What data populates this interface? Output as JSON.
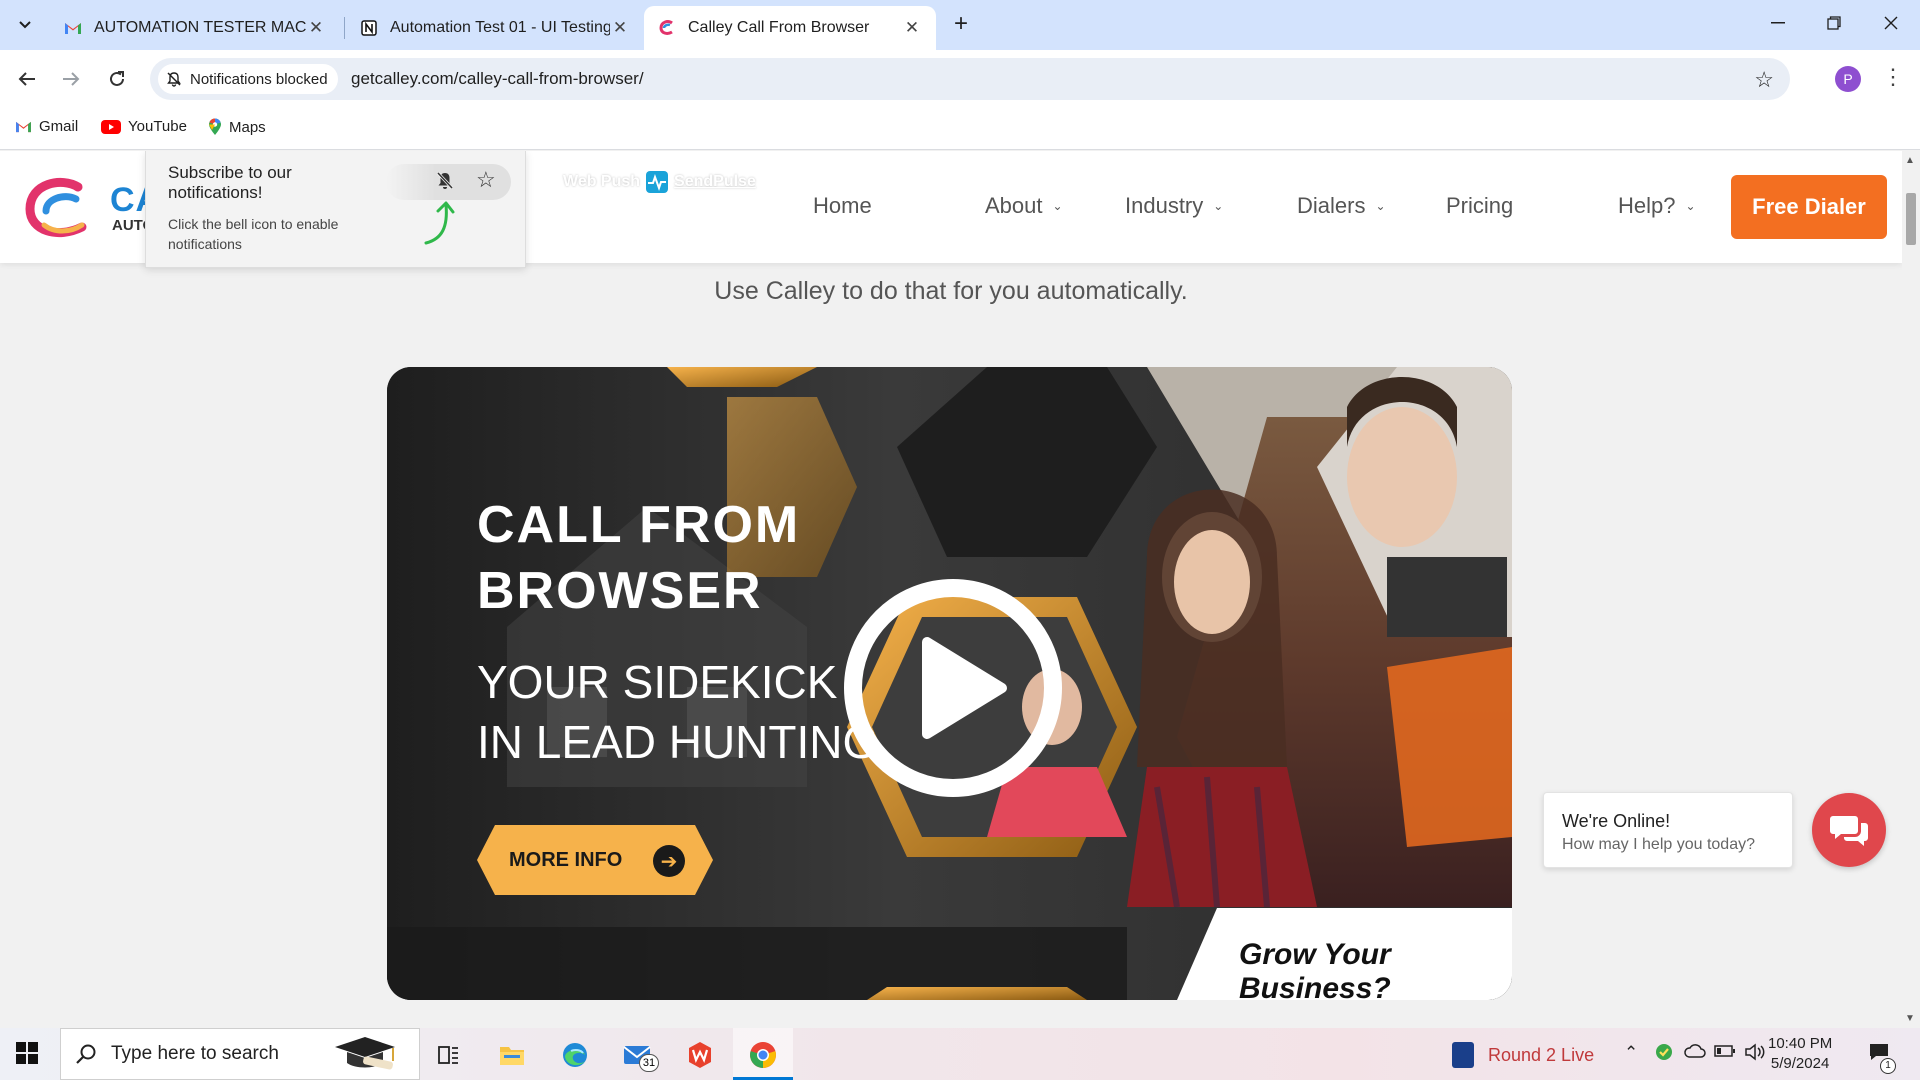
{
  "browser": {
    "tabs": [
      {
        "title": "AUTOMATION TESTER MACHIN",
        "favicon": "gmail-icon",
        "active": false
      },
      {
        "title": "Automation Test 01 - UI Testing",
        "favicon": "notion-icon",
        "active": false
      },
      {
        "title": "Calley Call From Browser",
        "favicon": "calley-icon",
        "active": true
      }
    ],
    "new_tab": "+",
    "address": {
      "chip": "Notifications blocked",
      "url": "getcalley.com/calley-call-from-browser/"
    },
    "profile_initial": "P",
    "bookmarks": [
      {
        "label": "Gmail",
        "icon": "gmail-icon"
      },
      {
        "label": "YouTube",
        "icon": "youtube-icon"
      },
      {
        "label": "Maps",
        "icon": "maps-icon"
      }
    ]
  },
  "site": {
    "logo_text": "CA",
    "logo_sub": "AUTO",
    "nav": {
      "home": "Home",
      "about": "About",
      "industry": "Industry",
      "dialers": "Dialers",
      "pricing": "Pricing",
      "help": "Help?"
    },
    "cta": "Free Dialer",
    "tagline": "Use Calley to do that for you automatically.",
    "brand_color": "#f36f21"
  },
  "push_popup": {
    "title": "Subscribe to our notifications!",
    "text": "Click the bell icon to enable notifications",
    "powered_prefix": "Web Push",
    "powered_brand": "SendPulse"
  },
  "hero": {
    "title_line1": "CALL FROM",
    "title_line2": "BROWSER",
    "sub_line1": "YOUR SIDEKICK",
    "sub_line2": "IN LEAD HUNTING",
    "more_info": "MORE INFO",
    "grow": "Grow Your Business?",
    "accent": "#f6b24b"
  },
  "chat": {
    "title": "We're Online!",
    "subtitle": "How may I help you today?",
    "color": "#e0474c"
  },
  "taskbar": {
    "search_placeholder": "Type here to search",
    "mail_badge": "31",
    "news": "Round 2 Live",
    "time": "10:40 PM",
    "date": "5/9/2024",
    "notification_count": "1"
  }
}
